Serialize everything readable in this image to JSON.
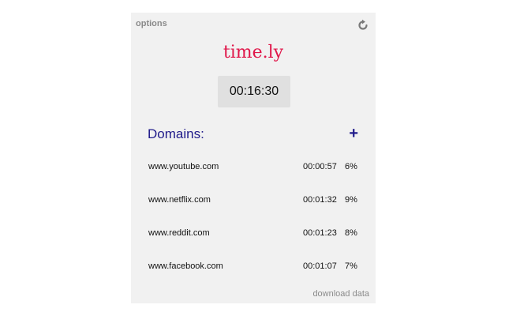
{
  "header": {
    "options_label": "options",
    "refresh_icon": "refresh-icon"
  },
  "logo": {
    "text": "time.ly",
    "color": "#e0174a"
  },
  "timer": {
    "total": "00:16:30"
  },
  "domains": {
    "title": "Domains:",
    "add_label": "+",
    "items": [
      {
        "name": "www.youtube.com",
        "time": "00:00:57",
        "percent": "6%"
      },
      {
        "name": "www.netflix.com",
        "time": "00:01:32",
        "percent": "9%"
      },
      {
        "name": "www.reddit.com",
        "time": "00:01:23",
        "percent": "8%"
      },
      {
        "name": "www.facebook.com",
        "time": "00:01:07",
        "percent": "7%"
      }
    ]
  },
  "footer": {
    "download_label": "download data"
  },
  "colors": {
    "accent": "#1f1a8a",
    "brand": "#e0174a",
    "panel_bg": "#f1f1f1"
  }
}
